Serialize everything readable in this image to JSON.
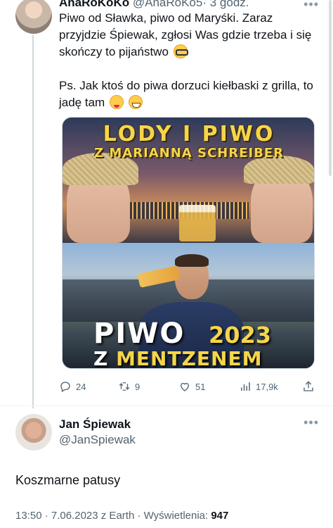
{
  "tweet1": {
    "author_name": "AnaRoKoKo",
    "handle": "@AnaRoKo5",
    "time": "· 3 godz.",
    "text_line1": "Piwo od Sławka, piwo od Maryśki. Zaraz przyjdzie Śpiewak, zgłosi Was gdzie trzeba i się skończy to pijaństwo",
    "text_line2": "Ps. Jak ktoś do piwa dorzuci kiełbaski z grilla, to jadę tam",
    "more_icon": "more-horizontal-icon",
    "media": {
      "top_title": "LODY I PIWO",
      "top_subtitle": "Z MARIANNĄ SCHREIBER",
      "bottom_title": "PIWO",
      "bottom_year": "2023",
      "bottom_z": "Z",
      "bottom_name": "MENTZENEM"
    },
    "actions": {
      "replies": "24",
      "retweets": "9",
      "likes": "51",
      "views": "17,9k"
    }
  },
  "tweet2": {
    "author_name": "Jan Śpiewak",
    "handle": "@JanSpiewak",
    "text": "Koszmarne patusy",
    "meta_text": "13:50 · 7.06.2023 z Earth · Wyświetlenia: ",
    "views": "947"
  },
  "colors": {
    "text_primary": "#0f1419",
    "text_secondary": "#536471",
    "thread_line": "#cfd9de",
    "poster_yellow": "#f6d54a"
  }
}
